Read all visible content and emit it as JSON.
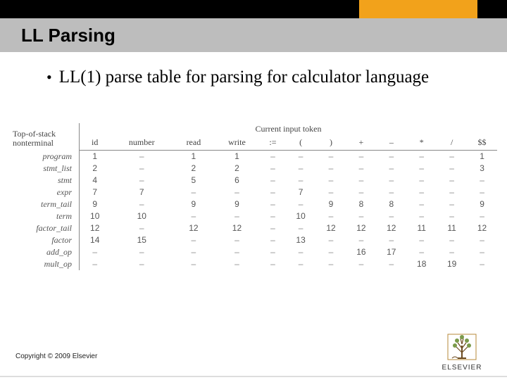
{
  "header": {
    "title": "LL Parsing"
  },
  "bullet": {
    "dot": "•",
    "text": "LL(1) parse table for parsing for calculator language"
  },
  "table": {
    "top_stack_label_line1": "Top-of-stack",
    "top_stack_label_line2": "nonterminal",
    "current_token_label": "Current input token",
    "columns": [
      "id",
      "number",
      "read",
      "write",
      ":=",
      "(",
      ")",
      "+",
      "–",
      "*",
      "/",
      "$$"
    ],
    "nonterminals": [
      "program",
      "stmt_list",
      "stmt",
      "expr",
      "term_tail",
      "term",
      "factor_tail",
      "factor",
      "add_op",
      "mult_op"
    ]
  },
  "chart_data": {
    "type": "table",
    "title": "LL(1) parse table for calculator language",
    "row_labels": [
      "program",
      "stmt_list",
      "stmt",
      "expr",
      "term_tail",
      "term",
      "factor_tail",
      "factor",
      "add_op",
      "mult_op"
    ],
    "col_labels": [
      "id",
      "number",
      "read",
      "write",
      ":=",
      "(",
      ")",
      "+",
      "–",
      "*",
      "/",
      "$$"
    ],
    "values": [
      [
        1,
        null,
        1,
        1,
        null,
        null,
        null,
        null,
        null,
        null,
        null,
        1
      ],
      [
        2,
        null,
        2,
        2,
        null,
        null,
        null,
        null,
        null,
        null,
        null,
        3
      ],
      [
        4,
        null,
        5,
        6,
        null,
        null,
        null,
        null,
        null,
        null,
        null,
        null
      ],
      [
        7,
        7,
        null,
        null,
        null,
        7,
        null,
        null,
        null,
        null,
        null,
        null
      ],
      [
        9,
        null,
        9,
        9,
        null,
        null,
        9,
        8,
        8,
        null,
        null,
        9
      ],
      [
        10,
        10,
        null,
        null,
        null,
        10,
        null,
        null,
        null,
        null,
        null,
        null
      ],
      [
        12,
        null,
        12,
        12,
        null,
        null,
        12,
        12,
        12,
        11,
        11,
        12
      ],
      [
        14,
        15,
        null,
        null,
        null,
        13,
        null,
        null,
        null,
        null,
        null,
        null
      ],
      [
        null,
        null,
        null,
        null,
        null,
        null,
        null,
        16,
        17,
        null,
        null,
        null
      ],
      [
        null,
        null,
        null,
        null,
        null,
        null,
        null,
        null,
        null,
        18,
        19,
        null
      ]
    ]
  },
  "footer": {
    "copyright": "Copyright © 2009 Elsevier",
    "logo_text": "ELSEVIER"
  }
}
